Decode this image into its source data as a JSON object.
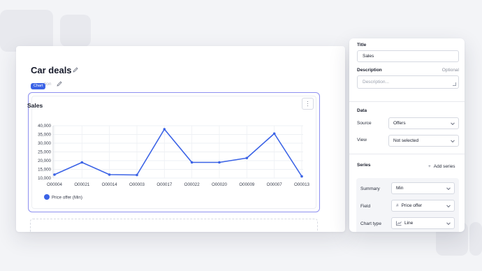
{
  "page": {
    "title": "Car deals",
    "subtitle_faint": "tion",
    "chip_label": "Chart"
  },
  "widget": {
    "title": "Sales",
    "menu_icon": "kebab-icon"
  },
  "chart_data": {
    "type": "line",
    "categories": [
      "O00004",
      "O00021",
      "O00014",
      "O00003",
      "O00017",
      "O00022",
      "O00020",
      "O00009",
      "O00007",
      "O00013"
    ],
    "series": [
      {
        "name": "Price offer (Min)",
        "values": [
          12000,
          19000,
          12000,
          11800,
          38000,
          19000,
          19000,
          21500,
          35500,
          11000
        ],
        "color": "#3b63e6"
      }
    ],
    "y_ticks": [
      "10,000",
      "15,000",
      "20,000",
      "25,000",
      "30,000",
      "35,000",
      "40,000"
    ],
    "ylim": [
      10000,
      40000
    ],
    "grid": true,
    "legend": "bottom-left"
  },
  "panel": {
    "title_label": "Title",
    "title_value": "Sales",
    "description_label": "Description",
    "description_optional": "Optional",
    "description_placeholder": "Description...",
    "data_header": "Data",
    "source_label": "Source",
    "source_value": "Offers",
    "view_label": "View",
    "view_value": "Not selected",
    "series_header": "Series",
    "add_series": "Add series",
    "summary_label": "Summary",
    "summary_value": "Min",
    "field_label": "Field",
    "field_value": "Price offer",
    "field_icon_glyph": "#",
    "charttype_label": "Chart type",
    "charttype_value": "Line"
  }
}
